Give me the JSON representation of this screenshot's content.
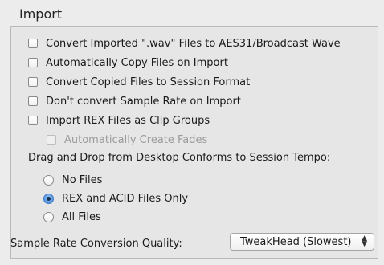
{
  "panel": {
    "title": "Import"
  },
  "options": [
    {
      "label": "Convert Imported \".wav\" Files to AES31/Broadcast Wave",
      "checked": false,
      "enabled": true
    },
    {
      "label": "Automatically Copy Files on Import",
      "checked": false,
      "enabled": true
    },
    {
      "label": "Convert Copied Files to Session Format",
      "checked": false,
      "enabled": true
    },
    {
      "label": "Don't convert Sample Rate on Import",
      "checked": false,
      "enabled": true
    },
    {
      "label": "Import REX Files as Clip Groups",
      "checked": false,
      "enabled": true
    },
    {
      "label": "Automatically Create Fades",
      "checked": false,
      "enabled": false
    }
  ],
  "drag_drop": {
    "heading": "Drag and Drop from Desktop Conforms to Session Tempo:",
    "choices": [
      {
        "label": "No Files",
        "selected": false
      },
      {
        "label": "REX and ACID Files Only",
        "selected": true
      },
      {
        "label": "All Files",
        "selected": false
      }
    ]
  },
  "quality": {
    "label": "Sample Rate Conversion Quality:",
    "value": "TweakHead (Slowest)"
  },
  "colors": {
    "accent": "#3b82d9",
    "background": "#ececec"
  }
}
